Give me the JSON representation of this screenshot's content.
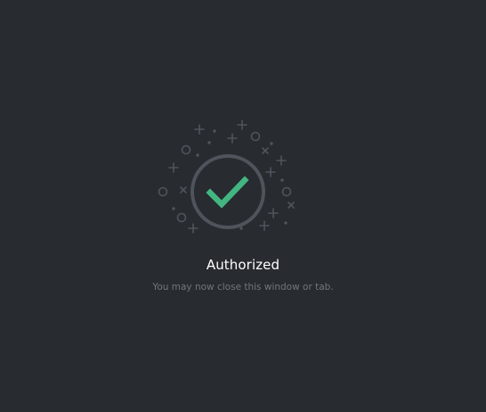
{
  "status": {
    "title": "Authorized",
    "message": "You may now close this window or tab."
  },
  "colors": {
    "background": "#282b30",
    "ring": "#4f545c",
    "check": "#43b581",
    "sparkle": "#4f545c",
    "title": "#ffffff",
    "message": "#72767d"
  },
  "icons": {
    "illustration": "success-check-icon",
    "decoration": "sparkles-icon"
  }
}
